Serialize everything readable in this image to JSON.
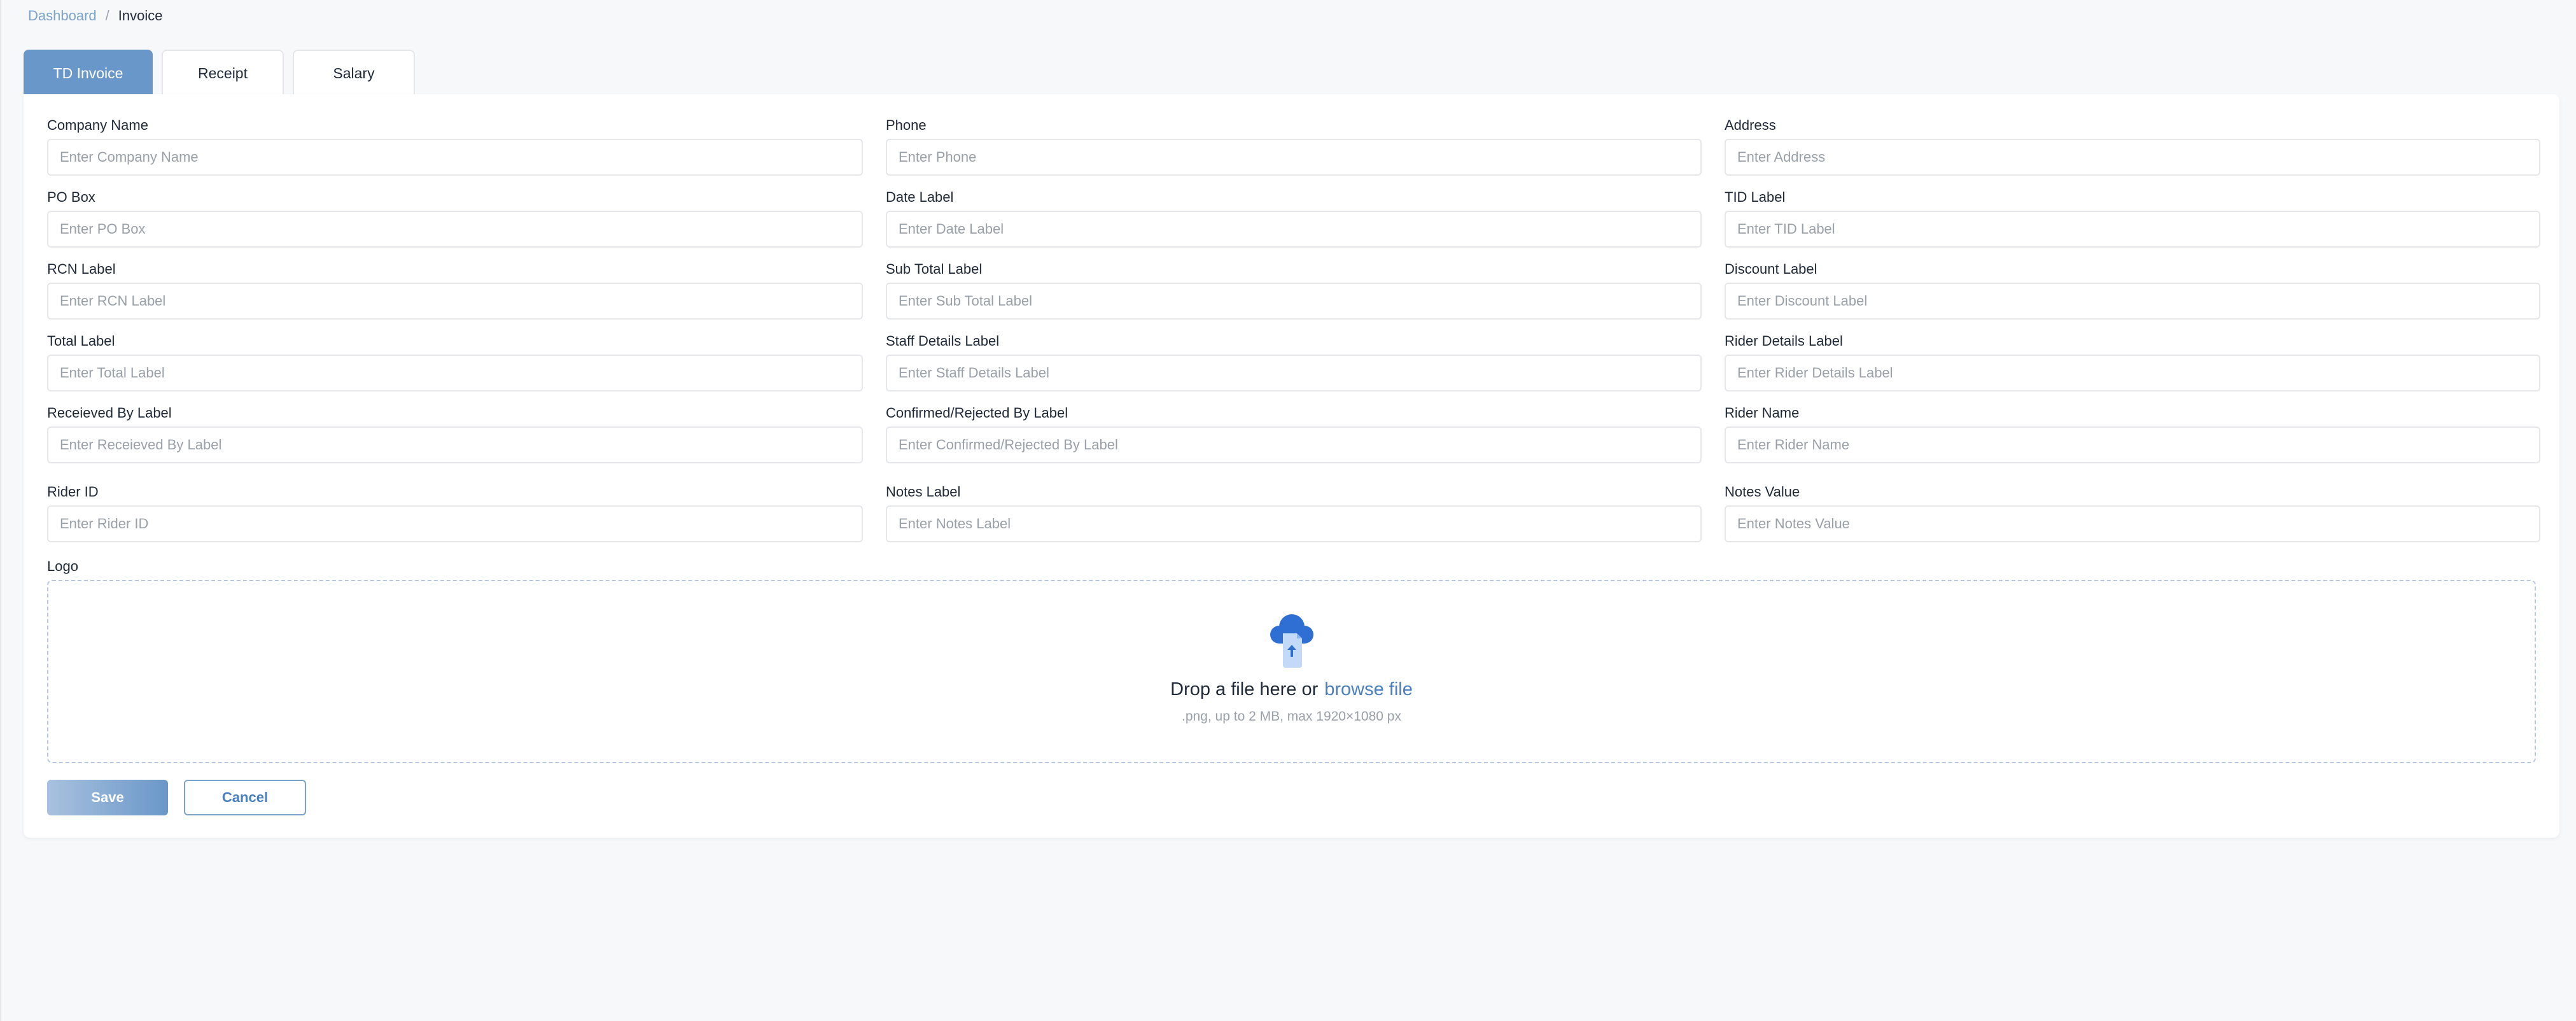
{
  "breadcrumb": {
    "root": "Dashboard",
    "separator": "/",
    "current": "Invoice"
  },
  "tabs": [
    {
      "label": "TD Invoice",
      "active": true
    },
    {
      "label": "Receipt",
      "active": false
    },
    {
      "label": "Salary",
      "active": false
    }
  ],
  "form": {
    "fields": [
      {
        "label": "Company Name",
        "placeholder": "Enter Company Name",
        "value": ""
      },
      {
        "label": "Phone",
        "placeholder": "Enter Phone",
        "value": ""
      },
      {
        "label": "Address",
        "placeholder": "Enter Address",
        "value": ""
      },
      {
        "label": "PO Box",
        "placeholder": "Enter PO Box",
        "value": ""
      },
      {
        "label": "Date Label",
        "placeholder": "Enter Date Label",
        "value": ""
      },
      {
        "label": "TID Label",
        "placeholder": "Enter TID Label",
        "value": ""
      },
      {
        "label": "RCN Label",
        "placeholder": "Enter RCN Label",
        "value": ""
      },
      {
        "label": "Sub Total Label",
        "placeholder": "Enter Sub Total Label",
        "value": ""
      },
      {
        "label": "Discount Label",
        "placeholder": "Enter Discount Label",
        "value": ""
      },
      {
        "label": "Total Label",
        "placeholder": "Enter Total Label",
        "value": ""
      },
      {
        "label": "Staff Details Label",
        "placeholder": "Enter Staff Details Label",
        "value": ""
      },
      {
        "label": "Rider Details Label",
        "placeholder": "Enter Rider Details Label",
        "value": ""
      },
      {
        "label": "Receieved By Label",
        "placeholder": "Enter Receieved By Label",
        "value": ""
      },
      {
        "label": "Confirmed/Rejected By Label",
        "placeholder": "Enter Confirmed/Rejected By Label",
        "value": ""
      },
      {
        "label": "Rider Name",
        "placeholder": "Enter Rider Name",
        "value": ""
      },
      {
        "label": "Rider ID",
        "placeholder": "Enter Rider ID",
        "value": ""
      },
      {
        "label": "Notes Label",
        "placeholder": "Enter Notes Label",
        "value": ""
      },
      {
        "label": "Notes Value",
        "placeholder": "Enter Notes Value",
        "value": ""
      }
    ],
    "logo": {
      "label": "Logo",
      "drop_text": "Drop a file here or",
      "browse_text": "browse file",
      "hint": ".png, up to 2 MB, max 1920×1080 px",
      "icon": "cloud-upload-icon"
    }
  },
  "actions": {
    "save_label": "Save",
    "cancel_label": "Cancel"
  },
  "colors": {
    "accent": "#6a97c9",
    "link": "#4a7fbf",
    "background": "#f7f8fa",
    "border": "#e5e7eb"
  }
}
